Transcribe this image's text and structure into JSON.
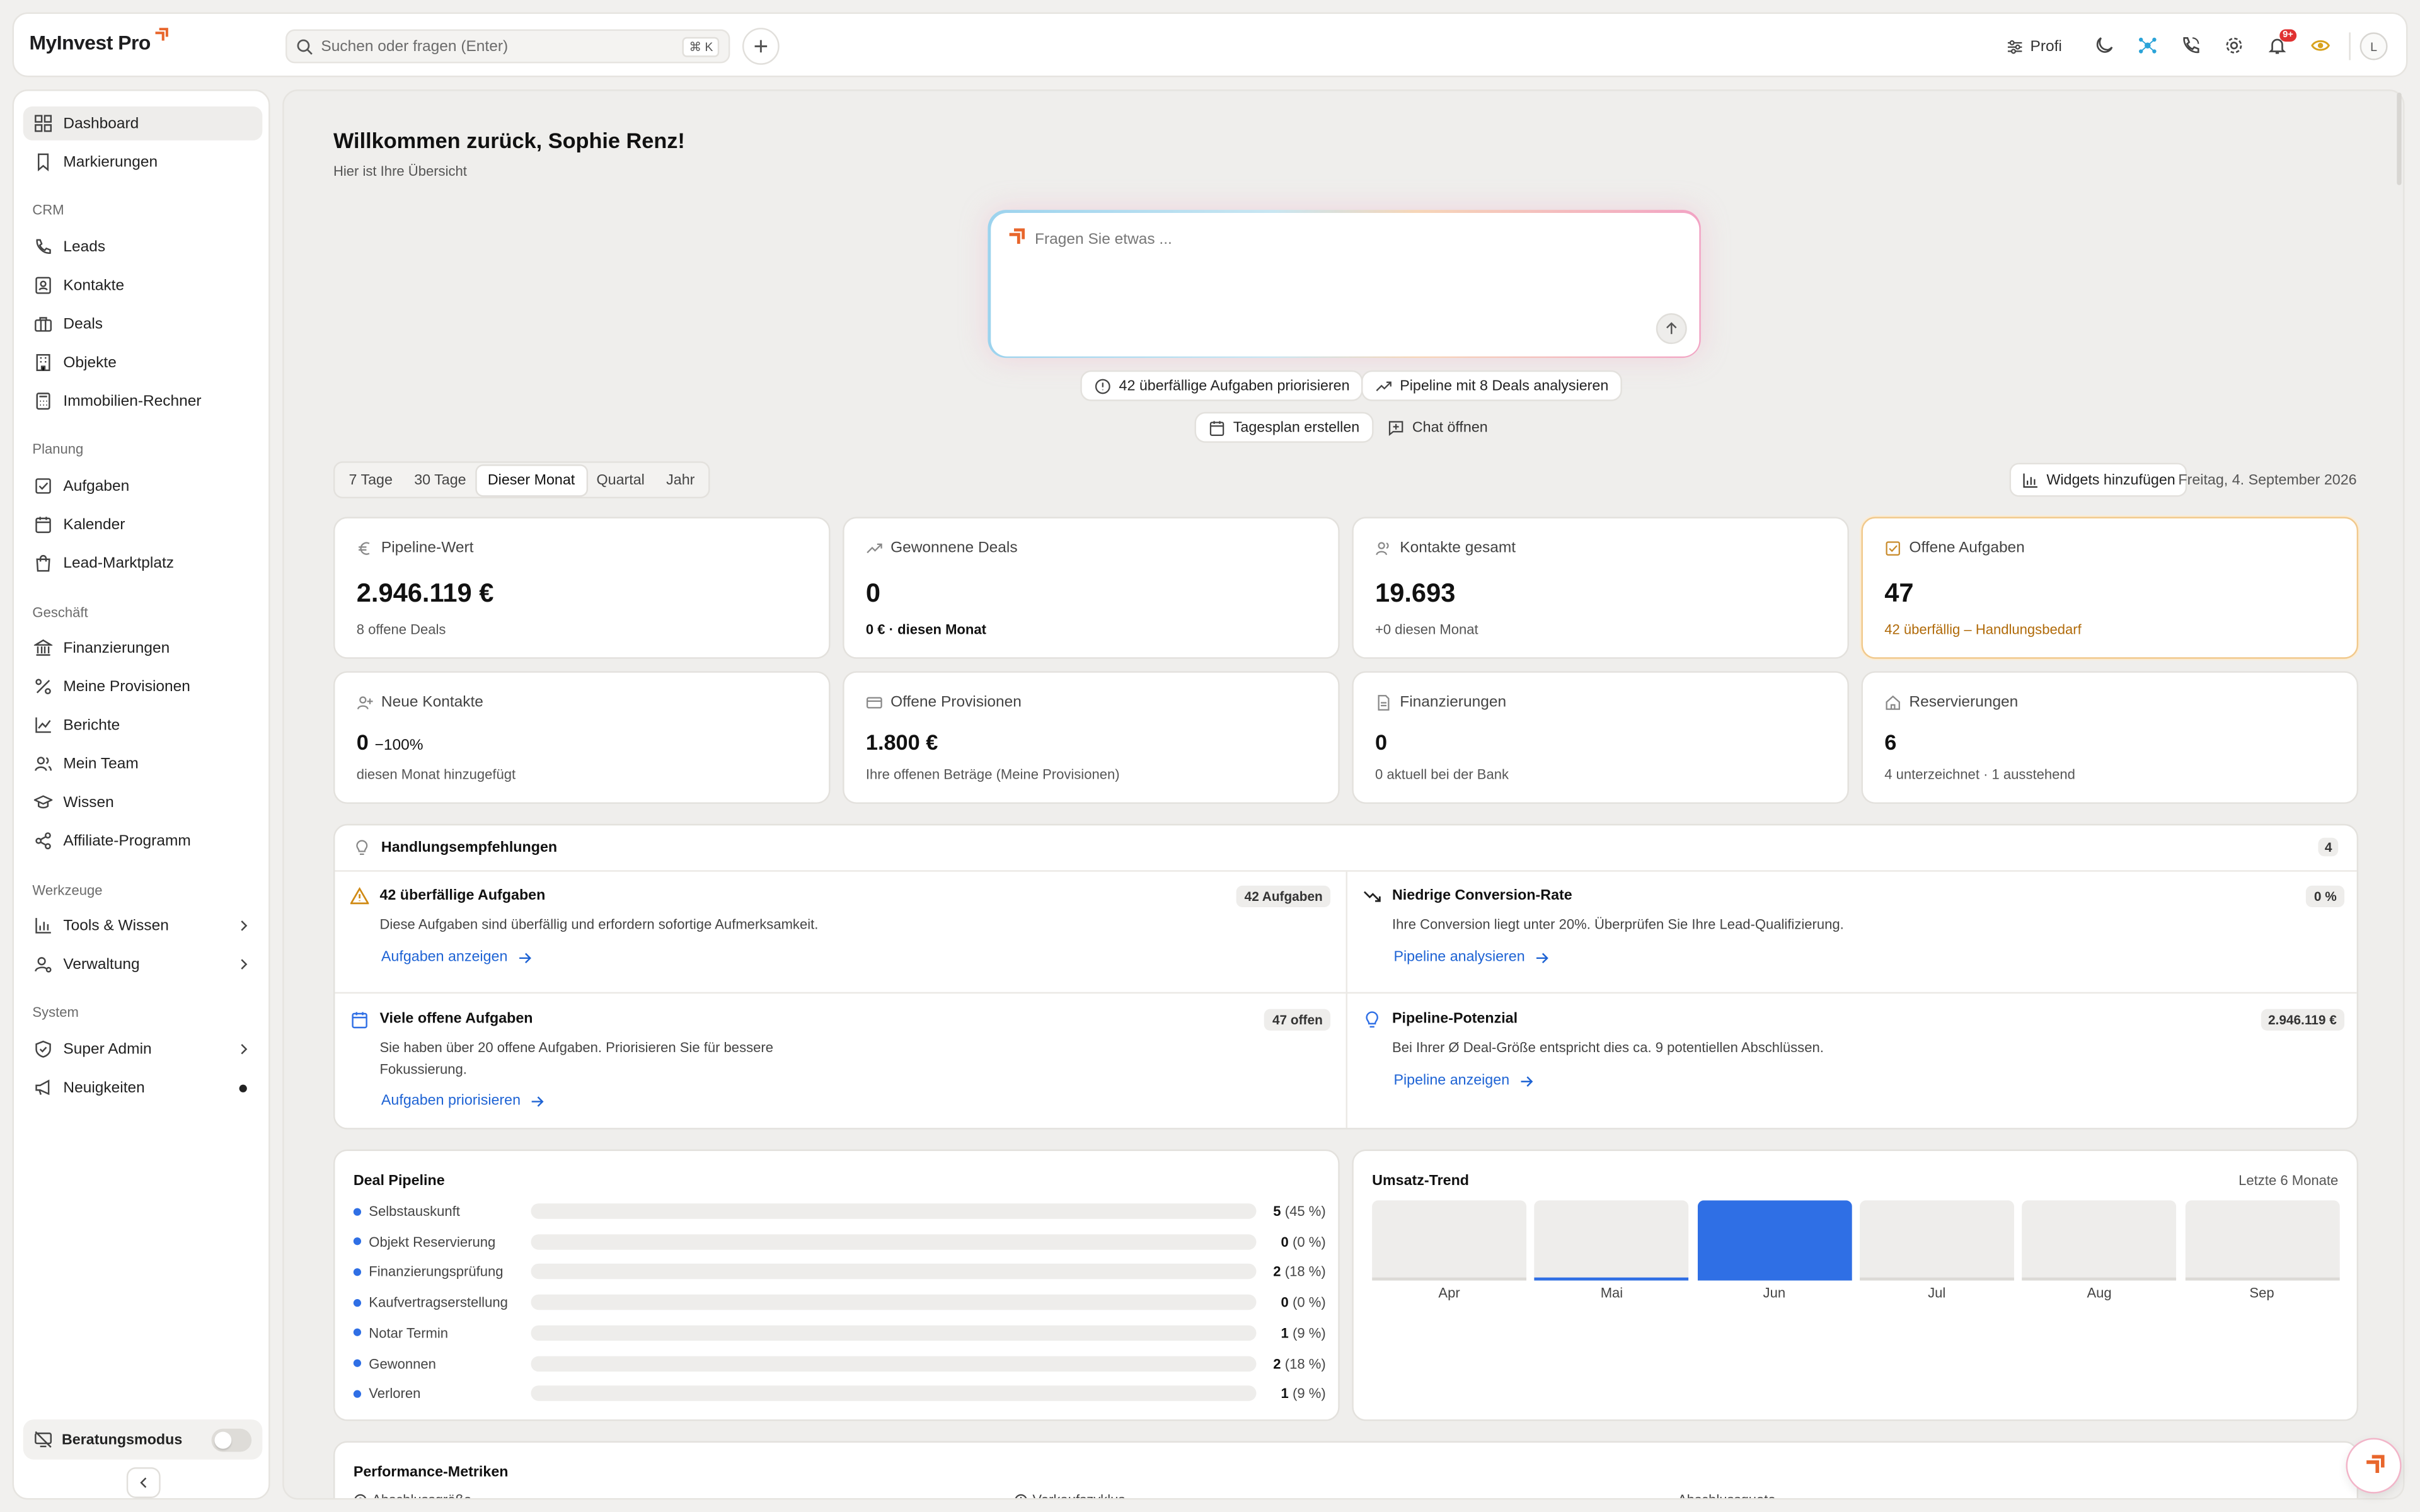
{
  "colors": {
    "accent": "#2f6fe5",
    "brand": "#e8662c",
    "warning": "#c88a2a",
    "link": "#1e63d4"
  },
  "header": {
    "logo": "MyInvest Pro",
    "search_placeholder": "Suchen oder fragen (Enter)",
    "search_shortcut": "⌘ K",
    "profi_label": "Profi",
    "notification_badge": "9+",
    "avatar_initial": "L"
  },
  "sidebar": {
    "top": [
      {
        "label": "Dashboard",
        "icon": "grid-icon"
      },
      {
        "label": "Markierungen",
        "icon": "bookmark-icon"
      }
    ],
    "sections": {
      "crm": "CRM",
      "planung": "Planung",
      "geschaeft": "Geschäft",
      "werkzeuge": "Werkzeuge",
      "system": "System"
    },
    "crm": [
      {
        "label": "Leads"
      },
      {
        "label": "Kontakte"
      },
      {
        "label": "Deals"
      },
      {
        "label": "Objekte"
      },
      {
        "label": "Immobilien-Rechner"
      }
    ],
    "planung": [
      {
        "label": "Aufgaben"
      },
      {
        "label": "Kalender"
      },
      {
        "label": "Lead-Marktplatz"
      }
    ],
    "geschaeft": [
      {
        "label": "Finanzierungen"
      },
      {
        "label": "Meine Provisionen"
      },
      {
        "label": "Berichte"
      },
      {
        "label": "Mein Team"
      },
      {
        "label": "Wissen"
      },
      {
        "label": "Affiliate-Programm"
      }
    ],
    "werkzeuge": [
      {
        "label": "Tools & Wissen"
      },
      {
        "label": "Verwaltung"
      }
    ],
    "system": [
      {
        "label": "Super Admin"
      },
      {
        "label": "Neuigkeiten"
      }
    ],
    "consult_label": "Beratungsmodus"
  },
  "main": {
    "welcome": "Willkommen zurück, Sophie Renz!",
    "subtitle": "Hier ist Ihre Übersicht",
    "ask_placeholder": "Fragen Sie etwas ...",
    "chips": [
      "42 überfällige Aufgaben priorisieren",
      "Pipeline mit 8 Deals analysieren",
      "Tagesplan erstellen",
      "Chat öffnen"
    ],
    "periods": [
      "7 Tage",
      "30 Tage",
      "Dieser Monat",
      "Quartal",
      "Jahr"
    ],
    "active_period": "Dieser Monat",
    "widgets_button": "Widgets hinzufügen",
    "date": "Freitag, 4. September 2026"
  },
  "kpis": [
    {
      "title": "Pipeline-Wert",
      "value": "2.946.119 €",
      "sub": "8 offene Deals"
    },
    {
      "title": "Gewonnene Deals",
      "value": "0",
      "sub": "0 € · diesen Monat"
    },
    {
      "title": "Kontakte gesamt",
      "value": "19.693",
      "sub": "+0 diesen Monat"
    },
    {
      "title": "Offene Aufgaben",
      "value": "47",
      "sub": "42 überfällig – Handlungsbedarf"
    },
    {
      "title": "Neue Kontakte",
      "value": "0",
      "delta": "−100%",
      "sub": "diesen Monat hinzugefügt"
    },
    {
      "title": "Offene Provisionen",
      "value": "1.800 €",
      "sub": "Ihre offenen Beträge (Meine Provisionen)"
    },
    {
      "title": "Finanzierungen",
      "value": "0",
      "sub": "0 aktuell bei der Bank"
    },
    {
      "title": "Reservierungen",
      "value": "6",
      "sub": "4 unterzeichnet · 1 ausstehend"
    }
  ],
  "recommendations": {
    "title": "Handlungsempfehlungen",
    "count": "4",
    "items": [
      {
        "title": "42 überfällige Aufgaben",
        "desc": "Diese Aufgaben sind überfällig und erfordern sofortige Aufmerksamkeit.",
        "link": "Aufgaben anzeigen",
        "badge": "42 Aufgaben"
      },
      {
        "title": "Niedrige Conversion-Rate",
        "desc": "Ihre Conversion liegt unter 20%. Überprüfen Sie Ihre Lead-Qualifizierung.",
        "link": "Pipeline analysieren",
        "badge": "0 %"
      },
      {
        "title": "Viele offene Aufgaben",
        "desc": "Sie haben über 20 offene Aufgaben. Priorisieren Sie für bessere Fokussierung.",
        "link": "Aufgaben priorisieren",
        "badge": "47 offen"
      },
      {
        "title": "Pipeline-Potenzial",
        "desc": "Bei Ihrer Ø Deal-Größe entspricht dies ca. 9 potentiellen Abschlüssen.",
        "link": "Pipeline anzeigen",
        "badge": "2.946.119 €"
      }
    ]
  },
  "pipeline": {
    "title": "Deal Pipeline",
    "stages": [
      {
        "label": "Selbstauskunft",
        "count": "5",
        "pct": "(45 %)",
        "fraction": 0.45
      },
      {
        "label": "Objekt Reservierung",
        "count": "0",
        "pct": "(0 %)",
        "fraction": 0
      },
      {
        "label": "Finanzierungsprüfung",
        "count": "2",
        "pct": "(18 %)",
        "fraction": 0.18
      },
      {
        "label": "Kaufvertragserstellung",
        "count": "0",
        "pct": "(0 %)",
        "fraction": 0
      },
      {
        "label": "Notar Termin",
        "count": "1",
        "pct": "(9 %)",
        "fraction": 0.09
      },
      {
        "label": "Gewonnen",
        "count": "2",
        "pct": "(18 %)",
        "fraction": 0.18
      },
      {
        "label": "Verloren",
        "count": "1",
        "pct": "(9 %)",
        "fraction": 0.09
      }
    ]
  },
  "trend": {
    "title": "Umsatz-Trend",
    "range": "Letzte 6 Monate",
    "months": [
      {
        "label": "Apr",
        "fraction": 0
      },
      {
        "label": "Mai",
        "fraction": 0.04
      },
      {
        "label": "Jun",
        "fraction": 1
      },
      {
        "label": "Jul",
        "fraction": 0
      },
      {
        "label": "Aug",
        "fraction": 0
      },
      {
        "label": "Sep",
        "fraction": 0
      }
    ]
  },
  "performance": {
    "title": "Performance-Metriken",
    "subs": [
      "Abschlussgröße",
      "Verkaufszyklus",
      "Abschlussquote"
    ]
  }
}
